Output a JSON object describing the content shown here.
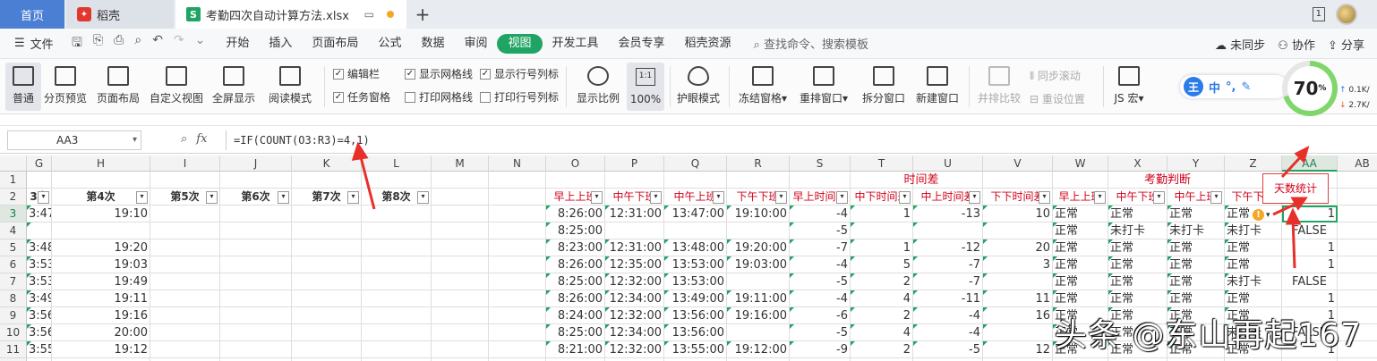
{
  "tabs": {
    "home": "首页",
    "daoke": "稻壳",
    "file": "考勤四次自动计算方法.xlsx",
    "new_tab": "+"
  },
  "window": {
    "page_badge": "1"
  },
  "menu": {
    "file": "文件",
    "items": [
      "开始",
      "插入",
      "页面布局",
      "公式",
      "数据",
      "审阅",
      "视图",
      "开发工具",
      "会员专享",
      "稻壳资源"
    ],
    "active_index": 6,
    "search": "查找命令、搜索模板",
    "right": [
      "未同步",
      "协作",
      "分享"
    ]
  },
  "ribbon": {
    "buttons": [
      "普通",
      "分页预览",
      "页面布局",
      "自定义视图",
      "全屏显示",
      "阅读模式"
    ],
    "checks": [
      {
        "label": "编辑栏",
        "on": true
      },
      {
        "label": "显示网格线",
        "on": true
      },
      {
        "label": "显示行号列标",
        "on": true
      },
      {
        "label": "任务窗格",
        "on": true
      },
      {
        "label": "打印网格线",
        "on": false
      },
      {
        "label": "打印行号列标",
        "on": false
      }
    ],
    "zoom_label": "显示比例",
    "zoom_ratio": "1:1",
    "zoom_value": "100%",
    "more": [
      "护眼模式",
      "冻结窗格",
      "重排窗口",
      "拆分窗口",
      "新建窗口"
    ],
    "disabled": [
      "并排比较",
      "同步滚动",
      "重设位置"
    ],
    "js": "JS 宏"
  },
  "widget": {
    "ime": [
      "王",
      "中",
      "°,",
      "✎"
    ],
    "gauge": "70",
    "gauge_unit": "%",
    "up": "0.1K/",
    "down": "2.7K/",
    "up_color": "#2a7ce8",
    "down_color": "#e8572a"
  },
  "formula_bar": {
    "cell_ref": "AA3",
    "fx": "fx",
    "formula": "=IF(COUNT(O3:R3)=4,1)"
  },
  "sheet": {
    "columns": [
      "G",
      "H",
      "I",
      "J",
      "K",
      "L",
      "M",
      "N",
      "O",
      "P",
      "Q",
      "R",
      "S",
      "T",
      "U",
      "V",
      "W",
      "X",
      "Y",
      "Z",
      "AA",
      "AB"
    ],
    "row_numbers": [
      "1",
      "2",
      "3",
      "4",
      "5",
      "6",
      "7",
      "8",
      "9",
      "10",
      "11",
      "12"
    ],
    "group_headers": {
      "time_diff": "时间差",
      "attendance": "考勤判断"
    },
    "header_row": [
      "3次",
      "第4次",
      "第5次",
      "第6次",
      "第7次",
      "第8次",
      "",
      "",
      "早上上班",
      "中午下班",
      "中午上班",
      "下午下班",
      "早上时间差",
      "中下时间差",
      "中上时间差",
      "下下时间差",
      "早上上班",
      "中午下班",
      "中午上班",
      "下午下班",
      "",
      ""
    ],
    "rows": [
      [
        "3:47",
        "19:10",
        "",
        "",
        "",
        "",
        "",
        "",
        "8:26:00",
        "12:31:00",
        "13:47:00",
        "19:10:00",
        "-4",
        "1",
        "-13",
        "10",
        "正常",
        "正常",
        "正常",
        "正常",
        "1",
        ""
      ],
      [
        "",
        "",
        "",
        "",
        "",
        "",
        "",
        "",
        "8:25:00",
        "",
        "",
        "",
        "-5",
        "",
        "",
        "",
        "正常",
        "未打卡",
        "未打卡",
        "未打卡",
        "FALSE",
        ""
      ],
      [
        "3:48",
        "19:20",
        "",
        "",
        "",
        "",
        "",
        "",
        "8:23:00",
        "12:31:00",
        "13:48:00",
        "19:20:00",
        "-7",
        "1",
        "-12",
        "20",
        "正常",
        "正常",
        "正常",
        "正常",
        "1",
        ""
      ],
      [
        "3:53",
        "19:03",
        "",
        "",
        "",
        "",
        "",
        "",
        "8:26:00",
        "12:35:00",
        "13:53:00",
        "19:03:00",
        "-4",
        "5",
        "-7",
        "3",
        "正常",
        "正常",
        "正常",
        "正常",
        "1",
        ""
      ],
      [
        "3:53",
        "19:49",
        "",
        "",
        "",
        "",
        "",
        "",
        "8:25:00",
        "12:32:00",
        "13:53:00",
        "",
        "-5",
        "2",
        "-7",
        "",
        "正常",
        "正常",
        "正常",
        "未打卡",
        "FALSE",
        ""
      ],
      [
        "3:49",
        "19:11",
        "",
        "",
        "",
        "",
        "",
        "",
        "8:26:00",
        "12:34:00",
        "13:49:00",
        "19:11:00",
        "-4",
        "4",
        "-11",
        "11",
        "正常",
        "正常",
        "正常",
        "正常",
        "1",
        ""
      ],
      [
        "3:56",
        "19:16",
        "",
        "",
        "",
        "",
        "",
        "",
        "8:24:00",
        "12:32:00",
        "13:56:00",
        "19:16:00",
        "-6",
        "2",
        "-4",
        "16",
        "正常",
        "正常",
        "正常",
        "正常",
        "1",
        ""
      ],
      [
        "3:56",
        "20:00",
        "",
        "",
        "",
        "",
        "",
        "",
        "8:25:00",
        "12:34:00",
        "13:56:00",
        "",
        "-5",
        "4",
        "-4",
        "",
        "正常",
        "正常",
        "正常",
        "未打卡",
        "FALSE",
        ""
      ],
      [
        "3:55",
        "19:12",
        "",
        "",
        "",
        "",
        "",
        "",
        "8:21:00",
        "12:32:00",
        "13:55:00",
        "19:12:00",
        "-9",
        "2",
        "-5",
        "12",
        "正常",
        "正常",
        "正常",
        "正常",
        "1",
        ""
      ]
    ],
    "callout": "天数统计",
    "row12_partial": [
      "3:??"
    ]
  },
  "watermark": "头条 @东山再起167",
  "colors": {
    "accent": "#1fa463",
    "header_red": "#d0021b",
    "tab_home": "#4a7fd4"
  }
}
